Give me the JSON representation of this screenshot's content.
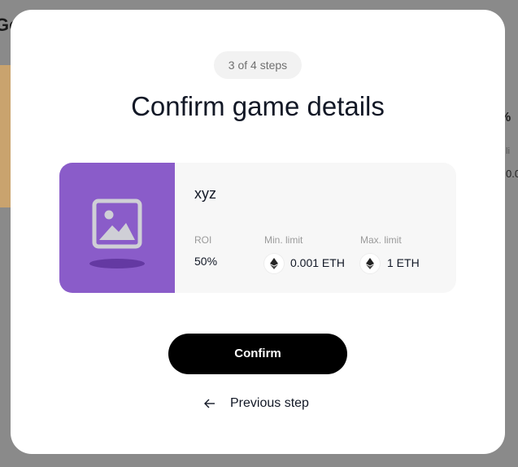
{
  "background": {
    "title_fragment": "Go",
    "percent_fragment": "%",
    "small_fragment_1": "li",
    "small_fragment_2": "0.0"
  },
  "modal": {
    "steps_label": "3 of 4 steps",
    "title": "Confirm game details",
    "game": {
      "thumbnail_icon": "image-placeholder-icon",
      "name": "xyz",
      "roi_label": "ROI",
      "roi_value": "50%",
      "min_limit_label": "Min. limit",
      "min_limit_value": "0.001 ETH",
      "max_limit_label": "Max. limit",
      "max_limit_value": "1 ETH",
      "currency_icon": "ethereum-icon"
    },
    "confirm_label": "Confirm",
    "previous_label": "Previous step"
  },
  "colors": {
    "thumbnail_bg": "#8a5cc9",
    "primary_button": "#000000",
    "card_bg": "#f7f7f7"
  }
}
